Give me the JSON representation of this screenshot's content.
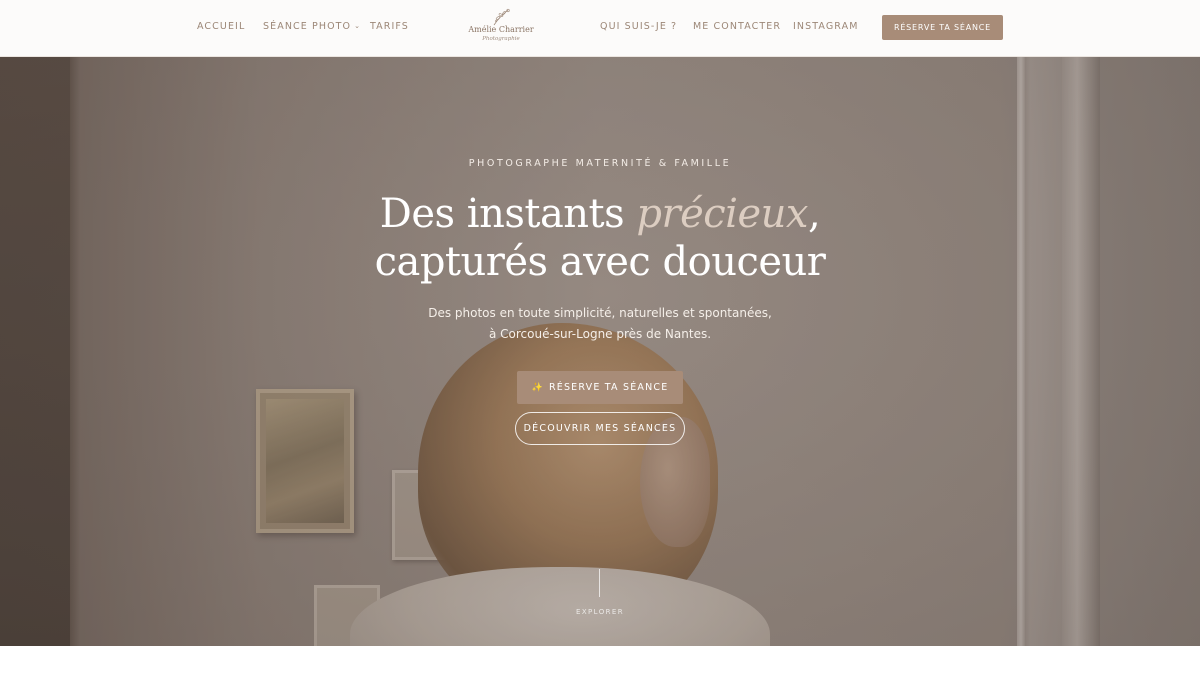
{
  "header": {
    "nav_left": {
      "accueil": "ACCUEIL",
      "seance_photo": "SÉANCE PHOTO",
      "tarifs": "TARIFS"
    },
    "logo": {
      "name": "Amélie Charrier",
      "tagline": "Photographie"
    },
    "nav_right": {
      "qui_suis_je": "QUI SUIS-JE ?",
      "contact": "ME CONTACTER",
      "instagram": "INSTAGRAM"
    },
    "cta_label": "RÉSERVE TA SÉANCE",
    "icons": {
      "dropdown": "chevron-down-icon",
      "logo_branch": "floral-branch-icon"
    }
  },
  "hero": {
    "eyebrow": "PHOTOGRAPHE MATERNITÉ & FAMILLE",
    "headline_part1": "Des instants ",
    "headline_accent": "précieux",
    "headline_part2": ",",
    "headline_line2": "capturés avec douceur",
    "subtext_line1": "Des photos en toute simplicité, naturelles et spontanées,",
    "subtext_line2": "à Corcoué-sur-Logne près de Nantes.",
    "primary_cta": "RÉSERVE TA SÉANCE",
    "primary_cta_icon": "sparkle-icon",
    "secondary_cta": "DÉCOUVRIR MES SÉANCES",
    "scroll_label": "EXPLORER"
  },
  "colors": {
    "brand": "#a88c78",
    "nav_text": "#9c8777",
    "accent_italic": "#dccdc1",
    "header_bg": "#fcfbfa"
  }
}
